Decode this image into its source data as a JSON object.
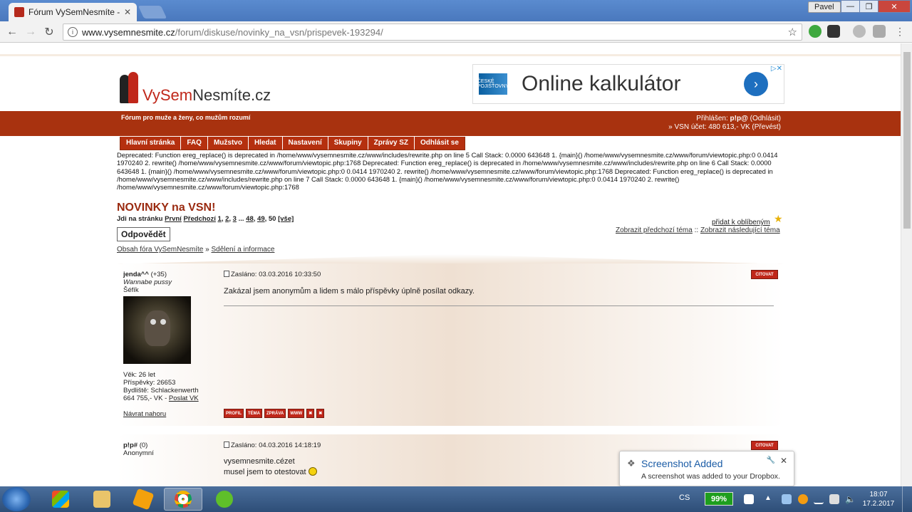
{
  "browser": {
    "tab_title": "Fórum VySemNesmíte - ",
    "tab_close": "✕",
    "profile_name": "Pavel",
    "url_host": "www.vysemnesmite.cz",
    "url_path": "/forum/diskuse/novinky_na_vsn/prispevek-193294/",
    "minimize": "—",
    "maximize": "❐",
    "close": "✕"
  },
  "site": {
    "logo_a": "VySem",
    "logo_b": "Nesmíte.cz",
    "tagline": "Fórum pro muže a ženy, co mužům rozumí",
    "login_line1_prefix": "Přihlášen: ",
    "login_user": "p!p@",
    "login_logout": "(Odhlásit)",
    "login_line2": "» VSN účet: 480 613,- VK (Převést)",
    "ad_text": "Online kalkulátor",
    "ad_brand": "ČESKÉ POJIŠŤOVNY",
    "menu": [
      "Hlavní stránka",
      "FAQ",
      "Mužstvo",
      "Hledat",
      "Nastavení",
      "Skupiny",
      "Zprávy SZ",
      "Odhlásit se"
    ]
  },
  "deprecated_text": "Deprecated: Function ereg_replace() is deprecated in /home/www/vysemnesmite.cz/www/includes/rewrite.php on line 5 Call Stack: 0.0000 643648 1. {main}() /home/www/vysemnesmite.cz/www/forum/viewtopic.php:0 0.0414 1970240 2. rewrite() /home/www/vysemnesmite.cz/www/forum/viewtopic.php:1768 Deprecated: Function ereg_replace() is deprecated in /home/www/vysemnesmite.cz/www/includes/rewrite.php on line 6 Call Stack: 0.0000 643648 1. {main}() /home/www/vysemnesmite.cz/www/forum/viewtopic.php:0 0.0414 1970240 2. rewrite() /home/www/vysemnesmite.cz/www/forum/viewtopic.php:1768 Deprecated: Function ereg_replace() is deprecated in /home/www/vysemnesmite.cz/www/includes/rewrite.php on line 7 Call Stack: 0.0000 643648 1. {main}() /home/www/vysemnesmite.cz/www/forum/viewtopic.php:0 0.0414 1970240 2. rewrite() /home/www/vysemnesmite.cz/www/forum/viewtopic.php:1768",
  "topic": {
    "title": "NOVINKY na VSN!",
    "pager_label": "Jdi na stránku",
    "pager_first": "První",
    "pager_prev": "Předchozí",
    "pager_pages": [
      "1",
      "2",
      "3"
    ],
    "pager_ellipsis": "...",
    "pager_tail": [
      "48",
      "49"
    ],
    "pager_current": "50",
    "pager_all": "[vše]",
    "reply": "Odpovědět",
    "add_fav": "přidat k oblíbeným",
    "prev_topic": "Zobrazit předchozí téma",
    "sep": "::",
    "next_topic": "Zobrazit následující téma",
    "crumb_1": "Obsah fóra VySemNesmíte",
    "crumb_sep": "»",
    "crumb_2": "Sdělení a informace"
  },
  "posts": [
    {
      "nick": "jenda^^",
      "karma": "(+35)",
      "rank": "Wannabe pussy",
      "role": "Šéfík",
      "age": "Věk: 26 let",
      "posts": "Příspěvky: 26653",
      "home": "Bydliště: Schlackenwerth",
      "balance": "664 755,- VK - ",
      "send_vk": "Poslat VK",
      "back_top": "Návrat nahoru",
      "meta": "Zasláno: 03.03.2016 10:33:50",
      "body": "Zakázal jsem anonymům a lidem s málo příspěvky úplně posílat odkazy.",
      "cite": "CITOVAT",
      "actions": [
        "PROFIL",
        "TÉMA",
        "ZPRÁVA",
        "WWW",
        "✖",
        "✖"
      ]
    },
    {
      "nick": "p!p#",
      "karma": "(0)",
      "role": "Anonymní",
      "meta": "Zasláno: 04.03.2016 14:18:19",
      "line1": "vysemnesmite.cézet",
      "line2": "musel jsem to otestovat",
      "cite": "CITOVAT"
    }
  ],
  "toast": {
    "title": "Screenshot Added",
    "message": "A screenshot was added to your Dropbox.",
    "close": "✕",
    "pin": "🔧"
  },
  "taskbar": {
    "lang": "CS",
    "battery": "99%",
    "time": "18:07",
    "date": "17.2.2017"
  },
  "colors": {
    "brand_red": "#a8320f",
    "accent_red": "#c0271a",
    "title_red": "#9a2a10"
  }
}
